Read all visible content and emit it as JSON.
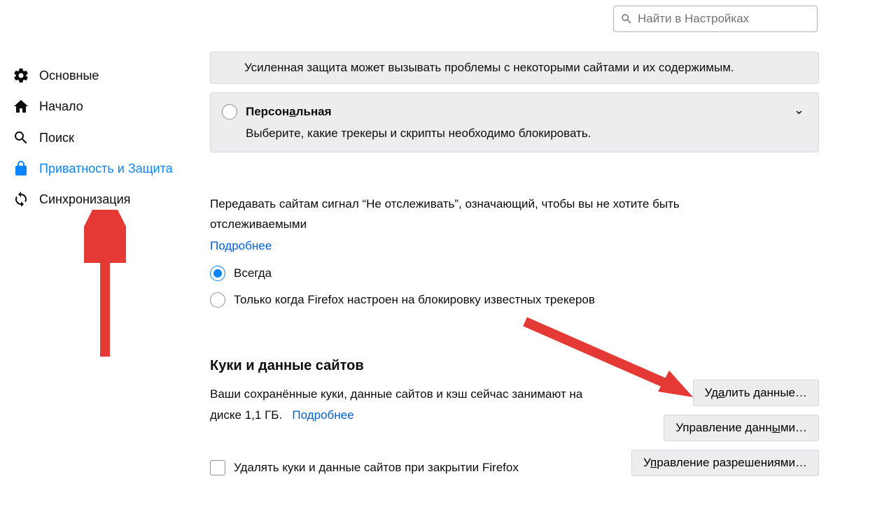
{
  "search": {
    "placeholder": "Найти в Настройках"
  },
  "sidebar": {
    "items": [
      {
        "label": "Основные"
      },
      {
        "label": "Начало"
      },
      {
        "label": "Поиск"
      },
      {
        "label": "Приватность и Защита"
      },
      {
        "label": "Синхронизация"
      }
    ]
  },
  "protection": {
    "info": "Усиленная защита может вызывать проблемы с некоторыми сайтами и их содержимым.",
    "custom_title_prefix": "Персон",
    "custom_title_ul": "а",
    "custom_title_suffix": "льная",
    "custom_sub": "Выберите, какие трекеры и скрипты необходимо блокировать."
  },
  "dnt": {
    "text": "Передавать сайтам сигнал “Не отслеживать”, означающий, чтобы вы не хотите быть отслеживаемыми",
    "learn_more": "Подробнее",
    "always": "Всегда",
    "only_when": "Только когда Firefox настроен на блокировку известных трекеров"
  },
  "cookies": {
    "title": "Куки и данные сайтов",
    "text_prefix": "Ваши сохранённые куки, данные сайтов и кэш сейчас занимают на диске ",
    "size": "1,1 ГБ.",
    "learn_more": "Подробнее",
    "delete_on_close": "Удалять куки и данные сайтов при закрытии Firefox",
    "btn_delete_pre": "Уд",
    "btn_delete_ul": "а",
    "btn_delete_post": "лить данные…",
    "btn_manage_pre": "Управление данн",
    "btn_manage_ul": "ы",
    "btn_manage_post": "ми…",
    "btn_perms_pre": "У",
    "btn_perms_ul": "п",
    "btn_perms_post": "равление разрешениями…"
  }
}
